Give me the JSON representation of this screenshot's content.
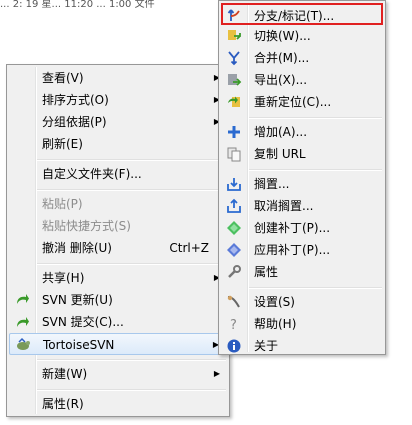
{
  "topline": "... 2: 19 星... 11:20 ... 1:00 文件",
  "main_menu": {
    "view": "查看(V)",
    "sort": "排序方式(O)",
    "group": "分组依据(P)",
    "refresh": "刷新(E)",
    "customize": "自定义文件夹(F)...",
    "paste": "粘贴(P)",
    "paste_shortcut": "粘贴快捷方式(S)",
    "undo_delete": "撤消 删除(U)",
    "undo_shortcut": "Ctrl+Z",
    "share": "共享(H)",
    "svn_update": "SVN 更新(U)",
    "svn_commit": "SVN 提交(C)...",
    "tortoisesvn": "TortoiseSVN",
    "new": "新建(W)",
    "properties": "属性(R)"
  },
  "sub_menu": {
    "branch_tag": "分支/标记(T)...",
    "switch": "切换(W)...",
    "merge": "合并(M)...",
    "export": "导出(X)...",
    "relocate": "重新定位(C)...",
    "add": "增加(A)...",
    "copy_url": "复制 URL",
    "shelve": "搁置...",
    "unshelve": "取消搁置...",
    "create_patch": "创建补丁(P)...",
    "apply_patch": "应用补丁(P)...",
    "properties": "属性",
    "settings": "设置(S)",
    "help": "帮助(H)",
    "about": "关于"
  },
  "colors": {
    "highlight_box": "#e02020",
    "hover": "#dceafa"
  }
}
